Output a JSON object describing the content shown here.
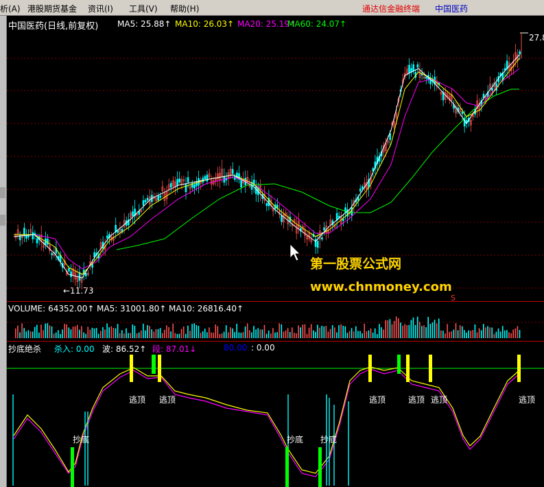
{
  "menu": {
    "items": [
      "析(A)",
      "港股期货基金",
      "资讯(I)",
      "工具(V)",
      "帮助(H)"
    ],
    "brand": "通达信金融终端",
    "stock": "中国医药"
  },
  "price_panel": {
    "title": "中国医药(日线,前复权)",
    "ma5": "MA5: 25.88↑",
    "ma10": "MA10: 26.03↑",
    "ma20": "MA20: 25.19↑",
    "ma60": "MA60: 24.07↑",
    "high_label": "27.8",
    "low_label": "←11.73"
  },
  "volume_panel": {
    "volume": "VOLUME: 64352.00↑",
    "ma5": "MA5: 31001.80↑",
    "ma10": "MA10: 26816.40↑"
  },
  "indicator_panel": {
    "name": "抄底绝杀",
    "buy": "杀入: 0.00",
    "wave": "波: 86.52↑",
    "seg": "段: 87.01↓",
    "level": "80.00",
    "zero": ": 0.00"
  },
  "signals": {
    "top_labels": [
      "逃顶",
      "逃顶",
      "逃顶",
      "逃顶",
      "逃顶",
      "逃顶"
    ],
    "bottom_labels": [
      "抄底",
      "抄底",
      "抄底"
    ]
  },
  "watermark": {
    "line1": "第一股票公式网",
    "line2": "www.chnmoney.com"
  },
  "marker": "S",
  "colors": {
    "ma5": "#ffffff",
    "ma10": "#ffff00",
    "ma20": "#ff00ff",
    "ma60": "#00ff00",
    "up": "#ff5050",
    "down": "#00ffff",
    "panel_border": "#c00000",
    "watermark": "#ffd400"
  }
}
